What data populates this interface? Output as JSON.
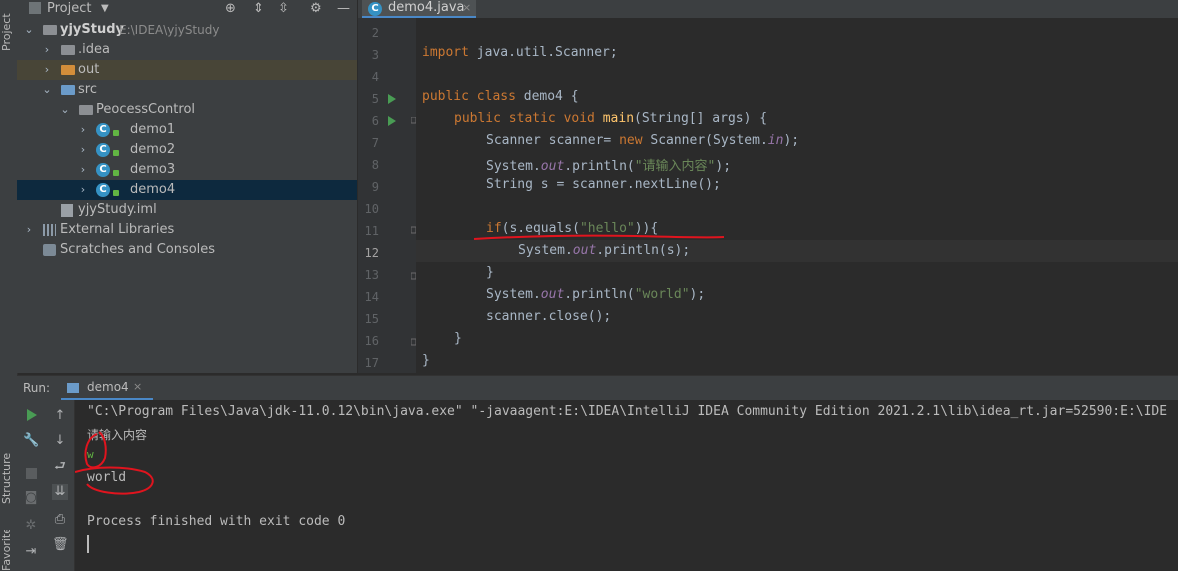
{
  "side_tabs": {
    "project": "Project",
    "structure": "Structure",
    "favorites": "Favorites"
  },
  "project_panel": {
    "title": "Project",
    "items": [
      {
        "label": "yjyStudy",
        "path": "E:\\IDEA\\yjyStudy"
      },
      {
        "label": ".idea"
      },
      {
        "label": "out"
      },
      {
        "label": "src"
      },
      {
        "label": "PeocessControl"
      },
      {
        "label": "demo1"
      },
      {
        "label": "demo2"
      },
      {
        "label": "demo3"
      },
      {
        "label": "demo4"
      },
      {
        "label": "yjyStudy.iml"
      },
      {
        "label": "External Libraries"
      },
      {
        "label": "Scratches and Consoles"
      }
    ]
  },
  "editor": {
    "tab_label": "demo4.java",
    "line_numbers": [
      "2",
      "3",
      "4",
      "5",
      "6",
      "7",
      "8",
      "9",
      "10",
      "11",
      "12",
      "13",
      "14",
      "15",
      "16",
      "17"
    ],
    "code": {
      "l3_kw": "import",
      "l3_rest": " java.util.Scanner;",
      "l5_kw": "public class",
      "l5_rest": " demo4 {",
      "l6_kw": "public static void",
      "l6_fn": "main",
      "l6_rest": "(String[] args) {",
      "l7_a": "Scanner scanner= ",
      "l7_kw": "new",
      "l7_b": " Scanner(System.",
      "l7_it": "in",
      "l7_c": ");",
      "l8_a": "System.",
      "l8_it": "out",
      "l8_b": ".println(",
      "l8_str": "\"请输入内容\"",
      "l8_c": ");",
      "l9": "String s = scanner.nextLine();",
      "l11_kw": "if",
      "l11_a": "(s.equals(",
      "l11_str": "\"hello\"",
      "l11_b": ")){",
      "l12_a": "System.",
      "l12_it": "out",
      "l12_b": ".println(s);",
      "l13": "}",
      "l14_a": "System.",
      "l14_it": "out",
      "l14_b": ".println(",
      "l14_str": "\"world\"",
      "l14_c": ");",
      "l15": "scanner.close();",
      "l16": "}",
      "l17": "}"
    }
  },
  "run_panel": {
    "label": "Run:",
    "tab_label": "demo4",
    "console": {
      "command": "\"C:\\Program Files\\Java\\jdk-11.0.12\\bin\\java.exe\" \"-javaagent:E:\\IDEA\\IntelliJ IDEA Community Edition 2021.2.1\\lib\\idea_rt.jar=52590:E:\\IDE",
      "prompt": "请输入内容",
      "input": "w",
      "output": "world",
      "exit": "Process finished with exit code 0"
    }
  },
  "colors": {
    "annotation": "#e0141e",
    "accent": "#3592c4"
  }
}
